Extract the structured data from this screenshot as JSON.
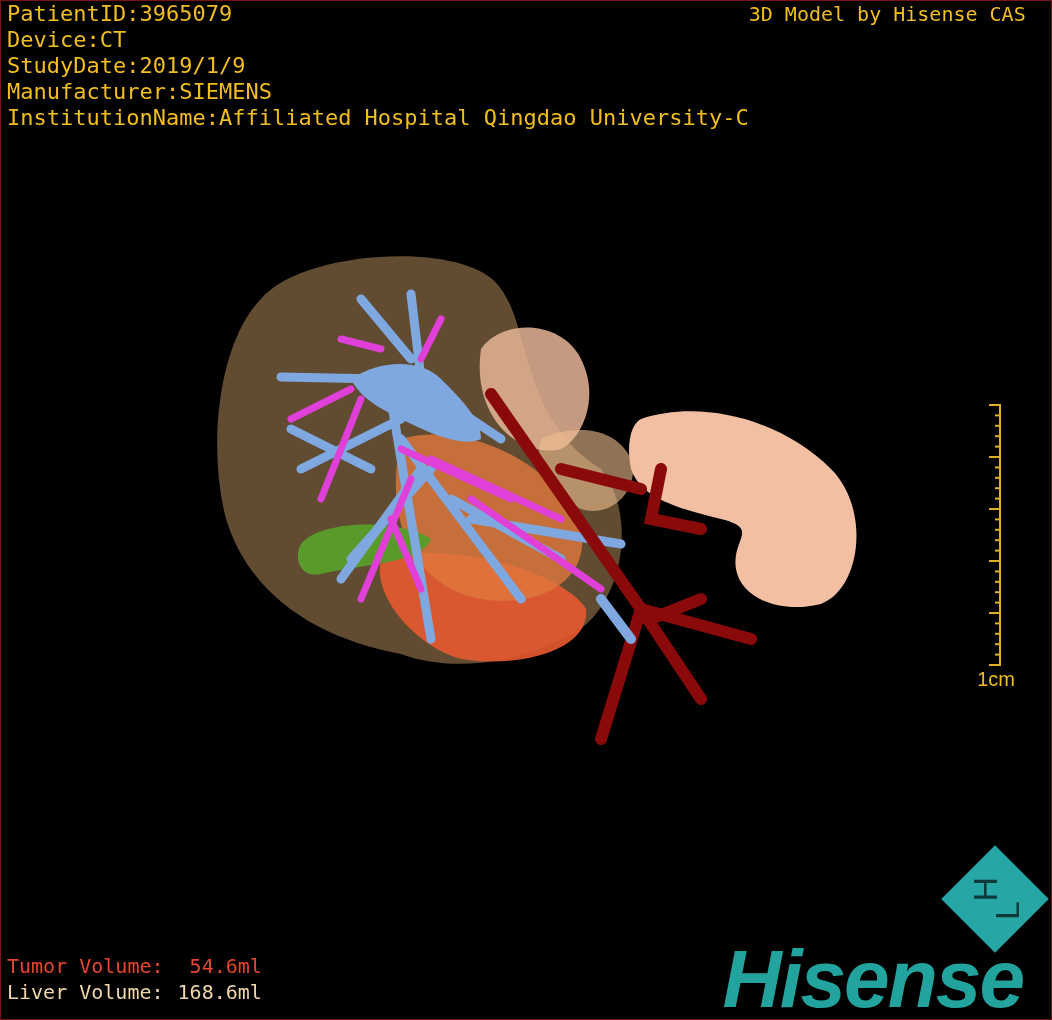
{
  "info_lines": [
    "PatientID:3965079",
    "Device:CT",
    "StudyDate:2019/1/9",
    "Manufacturer:SIEMENS",
    "InstitutionName:Affiliated Hospital Qingdao University-C"
  ],
  "title": "3D Model by Hisense CAS",
  "scale_bar": {
    "label": "1cm"
  },
  "volumes": [
    {
      "label": "Tumor Volume:",
      "value": "54.6ml",
      "color": "#e8452e"
    },
    {
      "label": "Liver Volume:",
      "value": "168.6ml",
      "color": "#f0d6a8"
    }
  ],
  "logo": {
    "mark_letters": [
      "H",
      "L"
    ],
    "wordmark": "Hisense"
  }
}
